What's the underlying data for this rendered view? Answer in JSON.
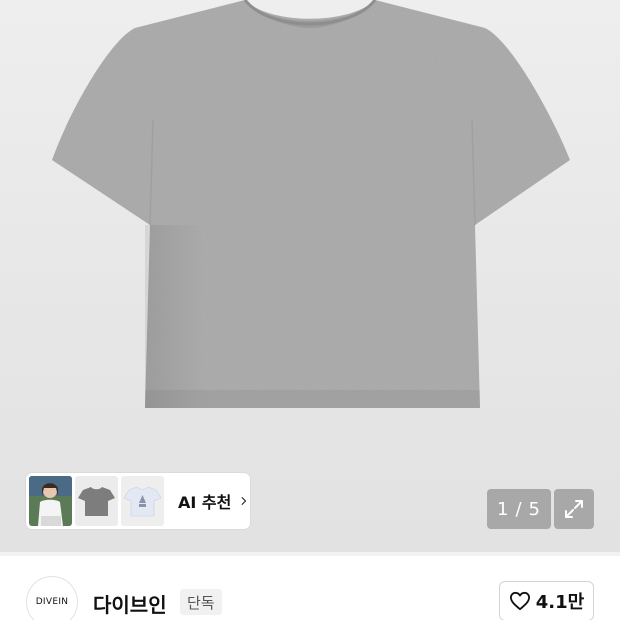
{
  "product_gallery": {
    "image_alt": "heather grey t-shirt",
    "counter": {
      "current": "1",
      "separator": "/",
      "total": "5"
    }
  },
  "ai_recommend": {
    "label": "AI 추천",
    "thumbnails": [
      "model-photo",
      "grey-tshirt",
      "white-graphic-tshirt"
    ]
  },
  "brand": {
    "logo_text": "DIVEIN",
    "name": "다이브인",
    "badge": "단독",
    "like_count": "4.1만"
  },
  "colors": {
    "shirt": "#a9a9a9",
    "hero_bg": "#e8e8e8",
    "overlay_button": "#8a8a8a"
  },
  "icons": {
    "ai_chevron": "chevron-right-icon",
    "expand": "expand-icon",
    "like": "heart-icon"
  }
}
